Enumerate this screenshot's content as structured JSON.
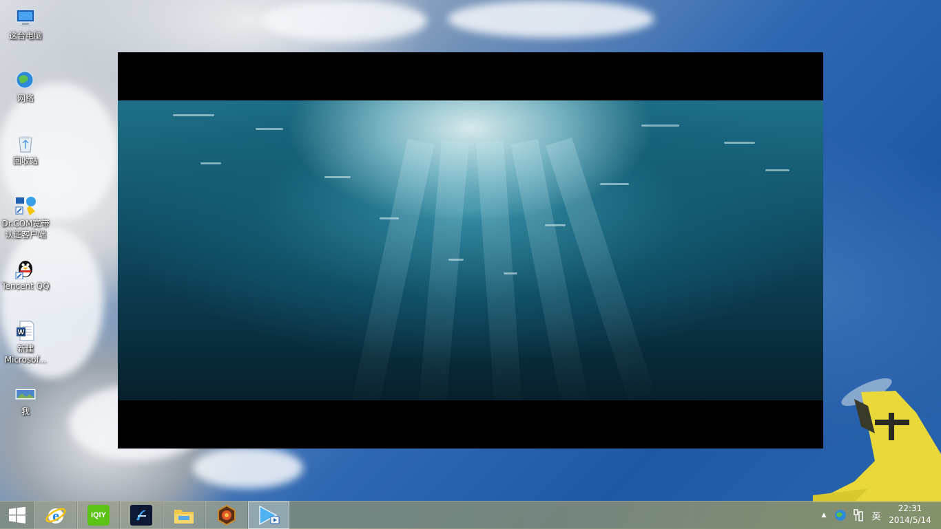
{
  "desktop": {
    "icons": [
      {
        "label": "这台电脑",
        "icon": "computer-icon"
      },
      {
        "label": "网络",
        "icon": "network-icon"
      },
      {
        "label": "回收站",
        "icon": "recycle-bin-icon"
      },
      {
        "label": "Dr.COM宽带认证客户端",
        "label_line1": "Dr.COM宽带",
        "label_line2": "认证客户端",
        "icon": "drcom-icon"
      },
      {
        "label": "Tencent QQ",
        "icon": "qq-penguin-icon"
      },
      {
        "label": "新建 Microsof...",
        "label_line1": "新建",
        "label_line2": "Microsof...",
        "icon": "word-document-icon"
      },
      {
        "label": "我",
        "icon": "image-file-icon"
      }
    ]
  },
  "video_window": {
    "content": "underwater-scene"
  },
  "taskbar": {
    "start": {
      "icon": "windows-logo-icon"
    },
    "apps": [
      {
        "name": "internet-explorer",
        "icon": "ie-icon"
      },
      {
        "name": "iqiyi",
        "icon": "iqiyi-icon",
        "text": "iQIY"
      },
      {
        "name": "app-3",
        "icon": "blue-app-icon"
      },
      {
        "name": "file-explorer",
        "icon": "folder-icon"
      },
      {
        "name": "app-5",
        "icon": "hexagon-app-icon"
      },
      {
        "name": "video-player",
        "icon": "video-player-icon",
        "active": true
      }
    ],
    "tray": {
      "show_hidden": "▲",
      "network": "network-globe-icon",
      "action_center": "flag-icon",
      "input_method": "英"
    },
    "clock": {
      "time": "22:31",
      "date": "2014/5/14"
    }
  },
  "colors": {
    "taskbar_tint": "#969678",
    "video_black": "#000000",
    "water_top": "#1f6f88",
    "water_bottom": "#071f2a"
  }
}
